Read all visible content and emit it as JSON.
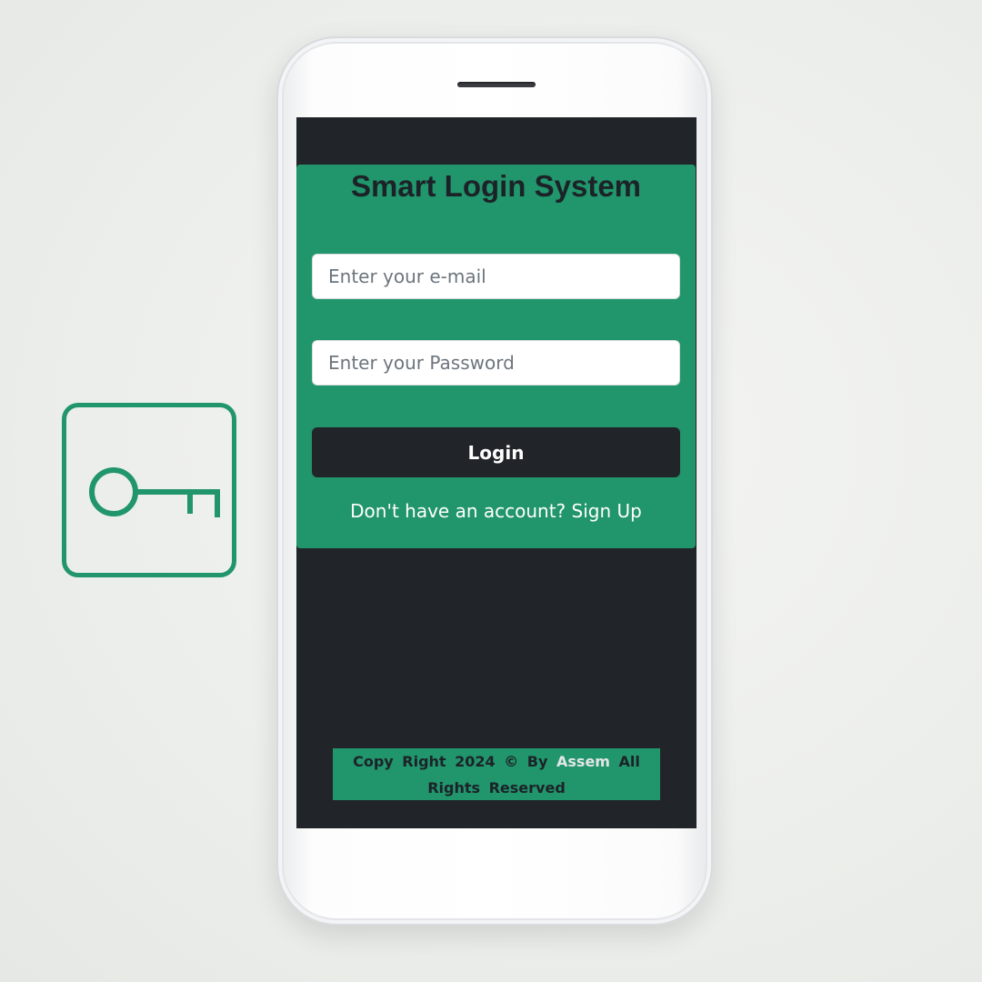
{
  "icons": {
    "key": "key-icon",
    "accent_color": "#21956b"
  },
  "app": {
    "title": "Smart Login System",
    "email_placeholder": "Enter your e-mail",
    "password_placeholder": "Enter your Password",
    "login_label": "Login",
    "signup_prompt": "Don't have an account?",
    "signup_link": "Sign Up"
  },
  "footer": {
    "prefix": "Copy Right 2024 © By",
    "author": "Assem",
    "suffix": "All Rights Reserved"
  },
  "colors": {
    "accent": "#21956b",
    "dark": "#212429",
    "title_text": "#1c2328"
  }
}
